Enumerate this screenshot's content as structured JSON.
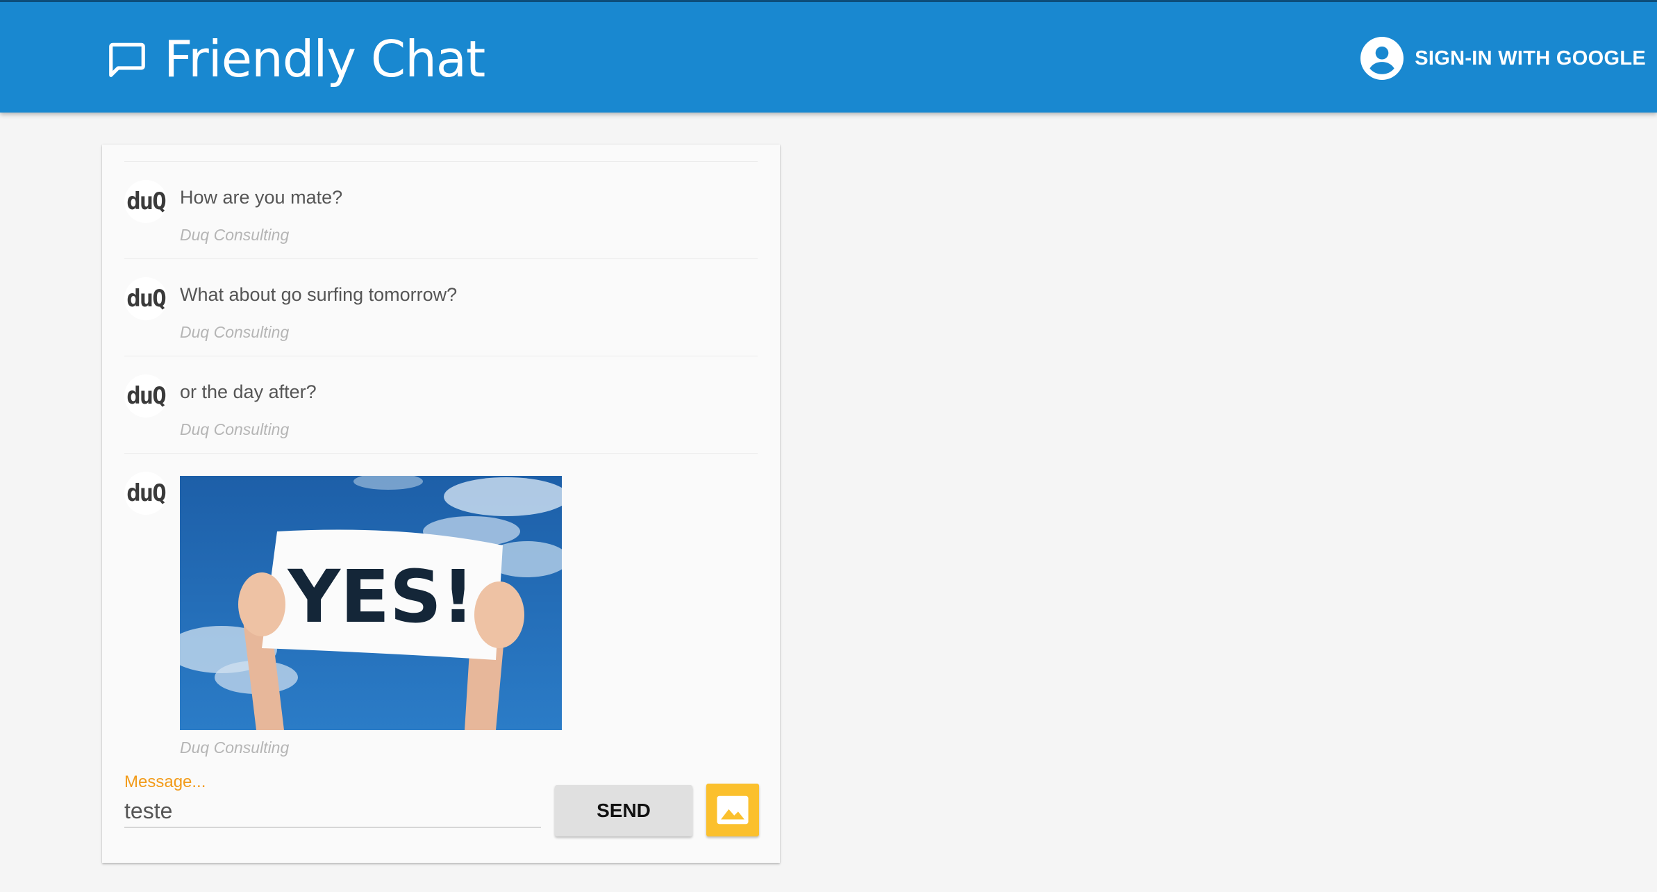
{
  "header": {
    "title": "Friendly Chat",
    "signin_label": "SIGN-IN WITH GOOGLE"
  },
  "messages": [
    {
      "avatar": "duQ",
      "text": "How are you mate?",
      "author": "Duq Consulting"
    },
    {
      "avatar": "duQ",
      "text": "What about go surfing tomorrow?",
      "author": "Duq Consulting"
    },
    {
      "avatar": "duQ",
      "text": "or the day after?",
      "author": "Duq Consulting"
    },
    {
      "avatar": "duQ",
      "image_text": "YES!",
      "author": "Duq Consulting"
    }
  ],
  "composer": {
    "label": "Message...",
    "value": "teste",
    "send_label": "SEND"
  },
  "colors": {
    "header": "#1988d0",
    "accent_label": "#f29b1a",
    "image_button": "#fbc02d"
  }
}
